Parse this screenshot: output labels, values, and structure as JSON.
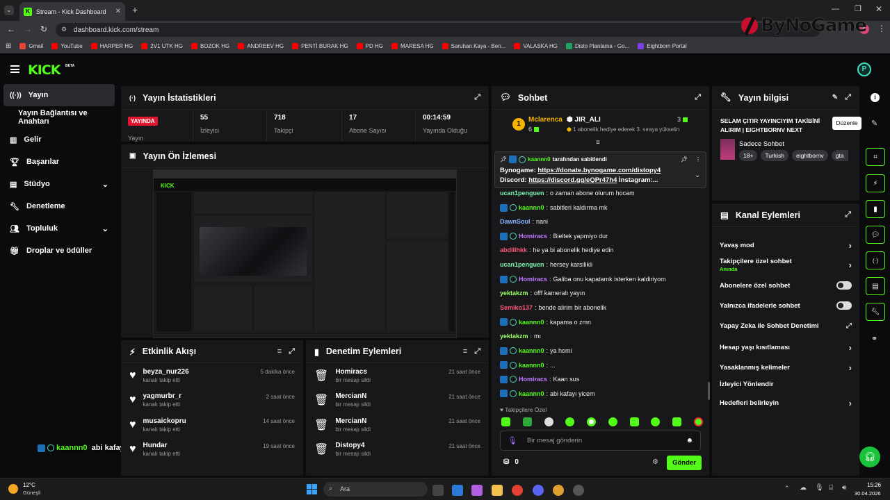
{
  "browser": {
    "tab_title": "Stream - Kick Dashboard",
    "url": "dashboard.kick.com/stream",
    "profile_initial": "A",
    "bookmarks": [
      "Gmail",
      "YouTube",
      "HARPER HG",
      "2V1 UTK HG",
      "BOZOK HG",
      "ANDREEV HG",
      "PENTİ BURAK HG",
      "PD HG",
      "MARESA HG",
      "Saruhan Kaya - Ben...",
      "VALASKA HG",
      "Disto Planlama - Go...",
      "Eightborn Portal"
    ]
  },
  "watermark": "ByNoGame",
  "brand": {
    "logo": "KICK",
    "beta": "BETA"
  },
  "sidebar": {
    "items": [
      {
        "label": "Yayın",
        "icon": "broadcast-icon"
      },
      {
        "label": "Yayın Bağlantısı ve Anahtarı",
        "icon": ""
      },
      {
        "label": "Gelir",
        "icon": "chart-icon"
      },
      {
        "label": "Başarılar",
        "icon": "trophy-icon"
      },
      {
        "label": "Stüdyo",
        "icon": "layout-icon"
      },
      {
        "label": "Denetleme",
        "icon": "wrench-icon"
      },
      {
        "label": "Topluluk",
        "icon": "users-icon"
      },
      {
        "label": "Droplar ve ödüller",
        "icon": "gift-icon"
      }
    ]
  },
  "stats": {
    "title": "Yayın İstatistikleri",
    "live_badge": "YAYINDA",
    "live_label": "Yayın",
    "items": [
      {
        "value": "55",
        "label": "İzleyici"
      },
      {
        "value": "718",
        "label": "Takipçi"
      },
      {
        "value": "17",
        "label": "Abone Sayısı"
      },
      {
        "value": "00:14:59",
        "label": "Yayında Olduğu"
      }
    ]
  },
  "preview": {
    "title": "Yayın Ön İzlemesi"
  },
  "overlay_chat": {
    "user": "kaannn0",
    "text": "abi kafayı yicem"
  },
  "activity": {
    "title": "Etkinlik Akışı",
    "items": [
      {
        "name": "beyza_nur226",
        "sub": "kanalı takip etti",
        "time": "5 dakika önce"
      },
      {
        "name": "yagmurbr_r",
        "sub": "kanalı takip etti",
        "time": "2 saat önce"
      },
      {
        "name": "musaickopru",
        "sub": "kanalı takip etti",
        "time": "14 saat önce"
      },
      {
        "name": "Hundar",
        "sub": "kanalı takip etti",
        "time": "19 saat önce"
      }
    ]
  },
  "moderation": {
    "title": "Denetim Eylemleri",
    "items": [
      {
        "name": "Homiracs",
        "sub": "bir mesajı sildi",
        "time": "21 saat önce"
      },
      {
        "name": "MercianN",
        "sub": "bir mesajı sildi",
        "time": "21 saat önce"
      },
      {
        "name": "MercianN",
        "sub": "bir mesajı sildi",
        "time": "21 saat önce"
      },
      {
        "name": "Distopy4",
        "sub": "bir mesajı sildi",
        "time": "21 saat önce"
      }
    ]
  },
  "chat": {
    "title": "Sohbet",
    "top_gifter": {
      "rank": "1",
      "name": "Mclarenca",
      "count": "6"
    },
    "gift_user": {
      "name": "JIR_ALI",
      "count": "3",
      "text": "1 abonelik hediye ederek 3. sıraya yükselin"
    },
    "pinned": {
      "by": "kaannn0",
      "by_suffix": "tarafından sabitlendi",
      "line1_label": "Bynogame:",
      "line1_link": "https://donate.bynogame.com/distopy4",
      "line2_label": "Discord:",
      "line2_link": "https://discord.gg/eQPr47h4",
      "line2_suffix": "İnstagram:..."
    },
    "messages": [
      {
        "user": "ucan1penguen",
        "color": "#7cf4ad",
        "text": "o zaman abone olurum hocam",
        "badges": false
      },
      {
        "user": "kaannn0",
        "color": "#53fc18",
        "text": "sabitleri kaldırma mk",
        "badges": true
      },
      {
        "user": "DawnSoul",
        "color": "#8ab4ff",
        "text": "nani",
        "badges": false
      },
      {
        "user": "Homiracs",
        "color": "#c57cff",
        "text": "Bieltek yapmiyo dur",
        "badges": true
      },
      {
        "user": "abdlllhkk",
        "color": "#ff5577",
        "text": "he ya bi abonelik hediye edin",
        "badges": false
      },
      {
        "user": "ucan1penguen",
        "color": "#7cf4ad",
        "text": "hersey karsilikli",
        "badges": false
      },
      {
        "user": "Homiracs",
        "color": "#c57cff",
        "text": "Galiba onu kapatamk isterken kaldiriyom",
        "badges": true
      },
      {
        "user": "yektakzm",
        "color": "#9cff6a",
        "text": "offf kameralı yayın",
        "badges": false
      },
      {
        "user": "Semiko137",
        "color": "#ff5577",
        "text": "bende alirim bir abonelik",
        "badges": false
      },
      {
        "user": "kaannn0",
        "color": "#53fc18",
        "text": "kapama o zmn",
        "badges": true
      },
      {
        "user": "yektakzm",
        "color": "#9cff6a",
        "text": "mı",
        "badges": false
      },
      {
        "user": "kaannn0",
        "color": "#53fc18",
        "text": "ya homi",
        "badges": true
      },
      {
        "user": "kaannn0",
        "color": "#53fc18",
        "text": "...",
        "badges": true
      },
      {
        "user": "Homiracs",
        "color": "#c57cff",
        "text": "Kaan sus",
        "badges": true
      },
      {
        "user": "kaannn0",
        "color": "#53fc18",
        "text": "abi kafayı yicem",
        "badges": true
      }
    ],
    "followers_only": "Takipçilere Özel",
    "input_placeholder": "Bir mesaj gönderin",
    "points": "0",
    "send": "Gönder"
  },
  "stream_info": {
    "title": "Yayın bilgisi",
    "tooltip": "Düzenle",
    "stream_title": "SELAM ÇITIR YAYINCIYIM TAKİBİNİ ALIRIM | EIGHTBORNV NEXT",
    "category": "Sadece Sohbet",
    "tags": [
      "18+",
      "Turkish",
      "eightbornv",
      "gta"
    ]
  },
  "channel_actions": {
    "title": "Kanal Eylemleri",
    "items": [
      {
        "label": "Yavaş mod",
        "control": "chevron"
      },
      {
        "label": "Takipçilere özel sohbet",
        "sub": "Anında",
        "control": "chevron"
      },
      {
        "label": "Abonelere özel sohbet",
        "control": "toggle"
      },
      {
        "label": "Yalnızca ifadelerle sohbet",
        "control": "toggle"
      },
      {
        "label": "Yapay Zeka ile Sohbet Denetimi",
        "control": "external"
      },
      {
        "label": "Hesap yaşı kısıtlaması",
        "control": "chevron"
      },
      {
        "label": "Yasaklanmış kelimeler",
        "control": "chevron"
      },
      {
        "label": "İzleyici Yönlendir",
        "control": "none"
      },
      {
        "label": "Hedefleri belirleyin",
        "control": "chevron"
      }
    ]
  },
  "taskbar": {
    "weather_temp": "12°C",
    "weather_desc": "Güneşli",
    "search": "Ara",
    "time": "15:26",
    "date": "30.04.2026"
  },
  "colors": {
    "accent": "#53fc18",
    "panel": "#18181b",
    "bg": "#0b0b0d",
    "live": "#e3162f"
  }
}
